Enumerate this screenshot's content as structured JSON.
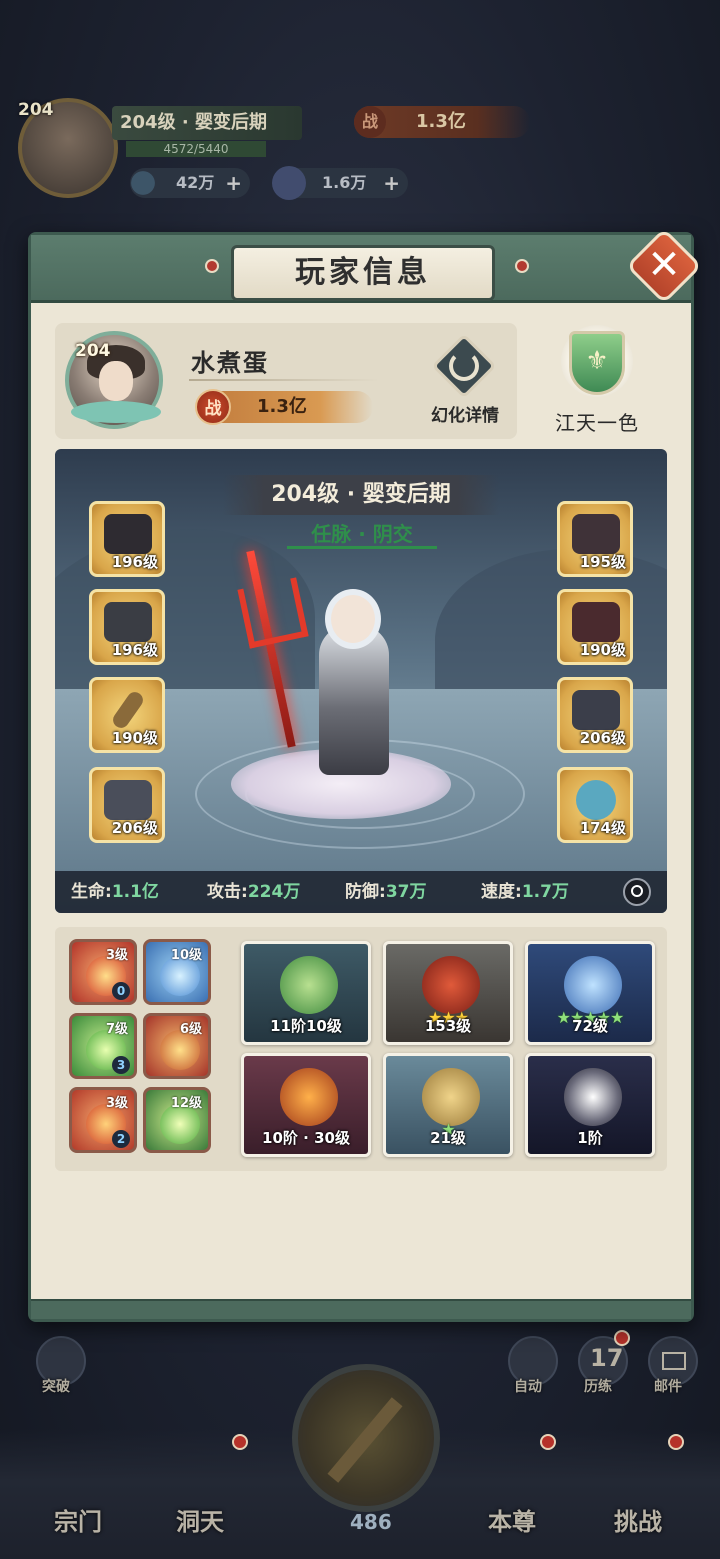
{
  "hud": {
    "level_badge": "204",
    "level_text": "204级 · 婴变后期",
    "xp": "4572/5440",
    "power_icon": "战",
    "power": "1.3亿",
    "currency1": "42万",
    "currency2": "1.6万",
    "plus": "+"
  },
  "modal": {
    "title": "玩家信息",
    "close_glyph": "✕"
  },
  "player": {
    "level": "204",
    "name": "水煮蛋",
    "power_icon": "战",
    "power": "1.3亿",
    "skin_details": "幻化详情",
    "guild_name": "江天一色"
  },
  "stage": {
    "level_text": "204级 · 婴变后期",
    "realm": "任脉 · 阴交"
  },
  "equipment_left": [
    {
      "name": "hat",
      "level": "196级"
    },
    {
      "name": "armor",
      "level": "196级"
    },
    {
      "name": "weapon",
      "level": "190级"
    },
    {
      "name": "bracer",
      "level": "206级"
    }
  ],
  "equipment_right": [
    {
      "name": "shoulder",
      "level": "195级"
    },
    {
      "name": "belt",
      "level": "190级"
    },
    {
      "name": "boots",
      "level": "206级"
    },
    {
      "name": "ring",
      "level": "174级"
    }
  ],
  "stats": {
    "hp_label": "生命:",
    "hp": "1.1亿",
    "atk_label": "攻击:",
    "atk": "224万",
    "def_label": "防御:",
    "def": "37万",
    "spd_label": "速度:",
    "spd": "1.7万"
  },
  "skills": [
    {
      "level": "3级",
      "count": "0",
      "color": "#c23a2a"
    },
    {
      "level": "10级",
      "count": "",
      "color": "#3a7fc2"
    },
    {
      "level": "7级",
      "count": "3",
      "color": "#3a9a3a"
    },
    {
      "level": "6级",
      "count": "",
      "color": "#c2542a"
    },
    {
      "level": "3级",
      "count": "2",
      "color": "#d0452a"
    },
    {
      "level": "12级",
      "count": "",
      "color": "#4aa83a"
    }
  ],
  "cards": [
    {
      "label": "11阶10级",
      "stars": ""
    },
    {
      "label": "153级",
      "stars": "★★★"
    },
    {
      "label": "72级",
      "stars": "★★★★★"
    },
    {
      "label": "10阶 · 30级",
      "stars": ""
    },
    {
      "label": "21级",
      "stars": "★"
    },
    {
      "label": "1阶",
      "stars": ""
    }
  ],
  "bottom": {
    "breakthrough": "突破",
    "auto": "自动",
    "trials_count": "17",
    "trials": "历练",
    "mail": "邮件",
    "sect": "宗门",
    "cave": "洞天",
    "center_count": "486",
    "self": "本尊",
    "challenge": "挑战"
  },
  "colors": {
    "panel_green": "#4c6a5d",
    "stat_value": "#7fd6a0",
    "realm_green": "#2f8f4b",
    "gold_frame": "#d9a64a"
  }
}
